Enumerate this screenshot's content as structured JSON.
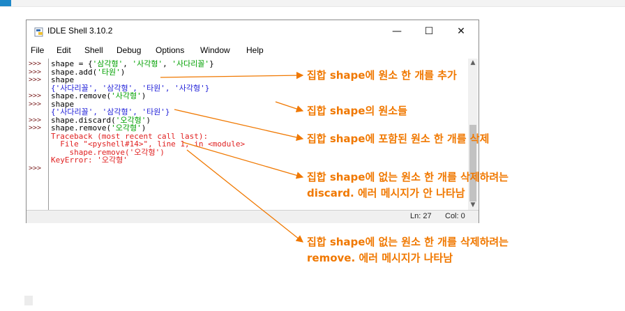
{
  "page": {
    "accent_color": "#1e88c8"
  },
  "window": {
    "title": "IDLE Shell 3.10.2",
    "icon": "python-file-icon",
    "controls": {
      "minimize": "—",
      "maximize": "☐",
      "close": "✕"
    }
  },
  "menu": [
    "File",
    "Edit",
    "Shell",
    "Debug",
    "Options",
    "Window",
    "Help"
  ],
  "shell": {
    "prompt": ">>>",
    "lines": [
      {
        "prompt": true,
        "parts": [
          {
            "t": "shape = {",
            "c": "in"
          },
          {
            "t": "'삼각형'",
            "c": "str"
          },
          {
            "t": ", ",
            "c": "in"
          },
          {
            "t": "'사각형'",
            "c": "str"
          },
          {
            "t": ", ",
            "c": "in"
          },
          {
            "t": "'사다리꼴'",
            "c": "str"
          },
          {
            "t": "}",
            "c": "in"
          }
        ]
      },
      {
        "prompt": true,
        "parts": [
          {
            "t": "shape.add(",
            "c": "in"
          },
          {
            "t": "'타원'",
            "c": "str"
          },
          {
            "t": ")",
            "c": "in"
          }
        ]
      },
      {
        "prompt": true,
        "parts": [
          {
            "t": "shape",
            "c": "in"
          }
        ]
      },
      {
        "prompt": false,
        "parts": [
          {
            "t": "{'사다리꼴', '삼각형', '타원', '사각형'}",
            "c": "out"
          }
        ]
      },
      {
        "prompt": true,
        "parts": [
          {
            "t": "shape.remove(",
            "c": "in"
          },
          {
            "t": "'사각형'",
            "c": "str"
          },
          {
            "t": ")",
            "c": "in"
          }
        ]
      },
      {
        "prompt": true,
        "parts": [
          {
            "t": "shape",
            "c": "in"
          }
        ]
      },
      {
        "prompt": false,
        "parts": [
          {
            "t": "{'사다리꼴', '삼각형', '타원'}",
            "c": "out"
          }
        ]
      },
      {
        "prompt": true,
        "parts": [
          {
            "t": "shape.discard(",
            "c": "in"
          },
          {
            "t": "'오각형'",
            "c": "str"
          },
          {
            "t": ")",
            "c": "in"
          }
        ]
      },
      {
        "prompt": true,
        "parts": [
          {
            "t": "shape.remove(",
            "c": "in"
          },
          {
            "t": "'오각형'",
            "c": "str"
          },
          {
            "t": ")",
            "c": "in"
          }
        ]
      },
      {
        "prompt": false,
        "parts": [
          {
            "t": "Traceback (most recent call last):",
            "c": "err"
          }
        ]
      },
      {
        "prompt": false,
        "parts": [
          {
            "t": "  File \"<pyshell#14>\", line 1, in <module>",
            "c": "err"
          }
        ]
      },
      {
        "prompt": false,
        "parts": [
          {
            "t": "    shape.remove('오각형')",
            "c": "err"
          }
        ]
      },
      {
        "prompt": false,
        "parts": [
          {
            "t": "KeyError: '오각형'",
            "c": "err"
          }
        ]
      },
      {
        "prompt": true,
        "parts": []
      }
    ]
  },
  "status": {
    "line": "Ln: 27",
    "col": "Col: 0"
  },
  "annotations": [
    "집합 shape에 원소 한 개를 추가",
    "집합 shape의 원소들",
    "집합 shape에 포함된 원소 한 개를 삭제",
    "집합 shape에 없는 원소 한 개를 삭제하려는",
    "discard. 에러 메시지가 안 나타남",
    "집합 shape에 없는 원소 한 개를 삭제하려는",
    "remove. 에러 메시지가 나타남"
  ],
  "colors": {
    "annotation": "#f07800",
    "prompt": "#7a1f1f",
    "string": "#00a000",
    "output": "#2020d8",
    "error": "#e02020"
  }
}
